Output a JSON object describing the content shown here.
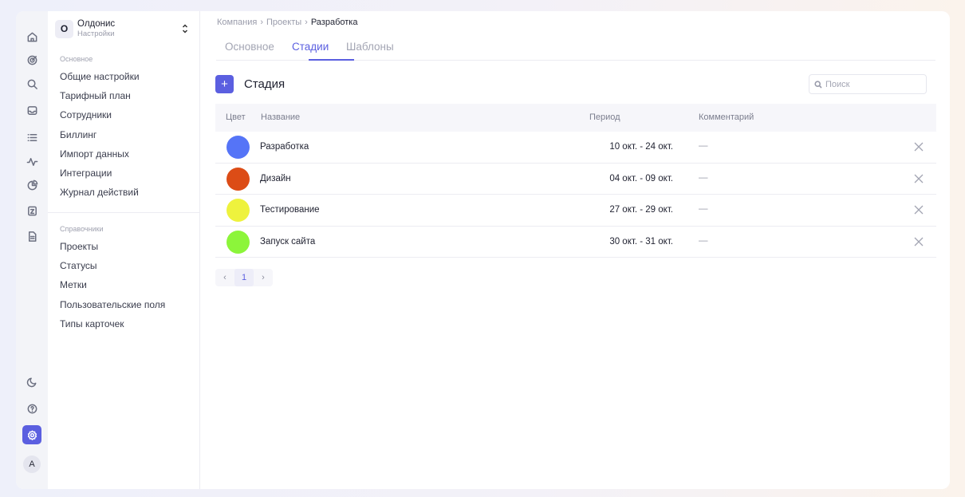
{
  "rail": {
    "items": [
      "home-icon",
      "target-icon",
      "search-icon",
      "inbox-icon",
      "list-icon",
      "activity-icon",
      "pie-chart-icon",
      "document-icon",
      "file-icon"
    ],
    "bottom": [
      "moon-icon",
      "help-icon",
      "settings-icon"
    ],
    "avatar": "A"
  },
  "org": {
    "badge": "О",
    "name": "Олдонис",
    "subtitle": "Настройки"
  },
  "sidebar": {
    "section_main": "Основное",
    "main_items": [
      "Общие настройки",
      "Тарифный план",
      "Сотрудники",
      "Биллинг",
      "Импорт данных",
      "Интеграции",
      "Журнал действий"
    ],
    "section_refs": "Справочники",
    "ref_items": [
      "Проекты",
      "Статусы",
      "Метки",
      "Пользовательские поля",
      "Типы карточек"
    ]
  },
  "breadcrumb": [
    "Компания",
    "Проекты",
    "Разработка"
  ],
  "tabs": [
    "Основное",
    "Стадии",
    "Шаблоны"
  ],
  "active_tab": "Стадии",
  "toolbar": {
    "add_label": "+",
    "title": "Стадия",
    "search_placeholder": "Поиск"
  },
  "table": {
    "columns": [
      "Цвет",
      "Название",
      "Период",
      "Комментарий"
    ],
    "rows": [
      {
        "color": "#5574f7",
        "name": "Разработка",
        "period": "10 окт. - 24 окт.",
        "comment": "—"
      },
      {
        "color": "#dc4c16",
        "name": "Дизайн",
        "period": "04 окт. - 09 окт.",
        "comment": "—"
      },
      {
        "color": "#eef23d",
        "name": "Тестирование",
        "period": "27 окт. - 29 окт.",
        "comment": "—"
      },
      {
        "color": "#8cf53a",
        "name": "Запуск сайта",
        "period": "30 окт. - 31 окт.",
        "comment": "—"
      }
    ]
  },
  "pagination": {
    "prev": "‹",
    "page": "1",
    "next": "›"
  },
  "colors": {
    "accent": "#5b5fe0"
  }
}
